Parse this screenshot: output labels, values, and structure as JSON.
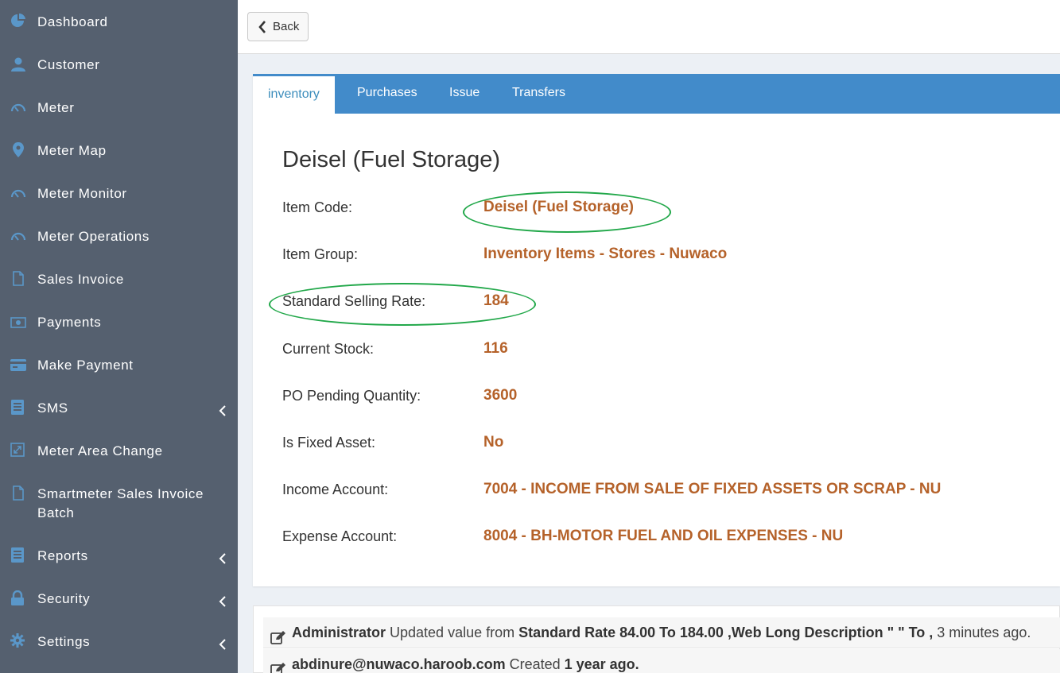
{
  "sidebar": {
    "items": [
      {
        "label": "Dashboard",
        "icon": "pie-chart-icon"
      },
      {
        "label": "Customer",
        "icon": "user-icon"
      },
      {
        "label": "Meter",
        "icon": "gauge-icon"
      },
      {
        "label": "Meter Map",
        "icon": "map-marker-icon"
      },
      {
        "label": "Meter Monitor",
        "icon": "gauge-icon"
      },
      {
        "label": "Meter Operations",
        "icon": "gauge-icon"
      },
      {
        "label": "Sales Invoice",
        "icon": "file-icon"
      },
      {
        "label": "Payments",
        "icon": "money-icon"
      },
      {
        "label": "Make Payment",
        "icon": "credit-card-icon"
      },
      {
        "label": "SMS",
        "icon": "message-book-icon"
      },
      {
        "label": "Meter Area Change",
        "icon": "resize-icon"
      },
      {
        "label": "Smartmeter Sales Invoice",
        "label2": "Batch",
        "icon": "file-icon"
      },
      {
        "label": "Reports",
        "icon": "report-book-icon"
      },
      {
        "label": "Security",
        "icon": "lock-icon"
      },
      {
        "label": "Settings",
        "icon": "gear-icon"
      }
    ]
  },
  "toolbar": {
    "back_label": "Back"
  },
  "tabs": [
    {
      "label": "inventory"
    },
    {
      "label": "Purchases"
    },
    {
      "label": "Issue"
    },
    {
      "label": "Transfers"
    }
  ],
  "item": {
    "title": "Deisel (Fuel Storage)",
    "fields": [
      {
        "label": "Item Code:",
        "value": "Deisel (Fuel Storage)"
      },
      {
        "label": "Item Group:",
        "value": "Inventory Items - Stores - Nuwaco"
      },
      {
        "label": "Standard Selling Rate:",
        "value": "184"
      },
      {
        "label": "Current Stock:",
        "value": "116"
      },
      {
        "label": "PO Pending Quantity:",
        "value": "3600"
      },
      {
        "label": "Is Fixed Asset:",
        "value": "No"
      },
      {
        "label": "Income Account:",
        "value": "7004 - INCOME FROM SALE OF FIXED ASSETS OR SCRAP - NU"
      },
      {
        "label": "Expense Account:",
        "value": "8004 - BH-MOTOR FUEL AND OIL EXPENSES - NU"
      }
    ]
  },
  "activity": [
    {
      "user": "Administrator",
      "text1": " Updated value from ",
      "bold1": "Standard Rate 84.00 To 184.00 ,Web Long Description \" \" To ,",
      "text2": " 3 minutes ago."
    },
    {
      "user": "abdinure@nuwaco.haroob.com",
      "text1": " Created ",
      "bold1": "1 year ago.",
      "text2": ""
    }
  ],
  "colors": {
    "sidebar_bg": "#55606f",
    "icon_blue": "#5a97c9",
    "tab_blue": "#428bca",
    "value_orange": "#b5622a",
    "highlight_green": "#22a84a"
  }
}
